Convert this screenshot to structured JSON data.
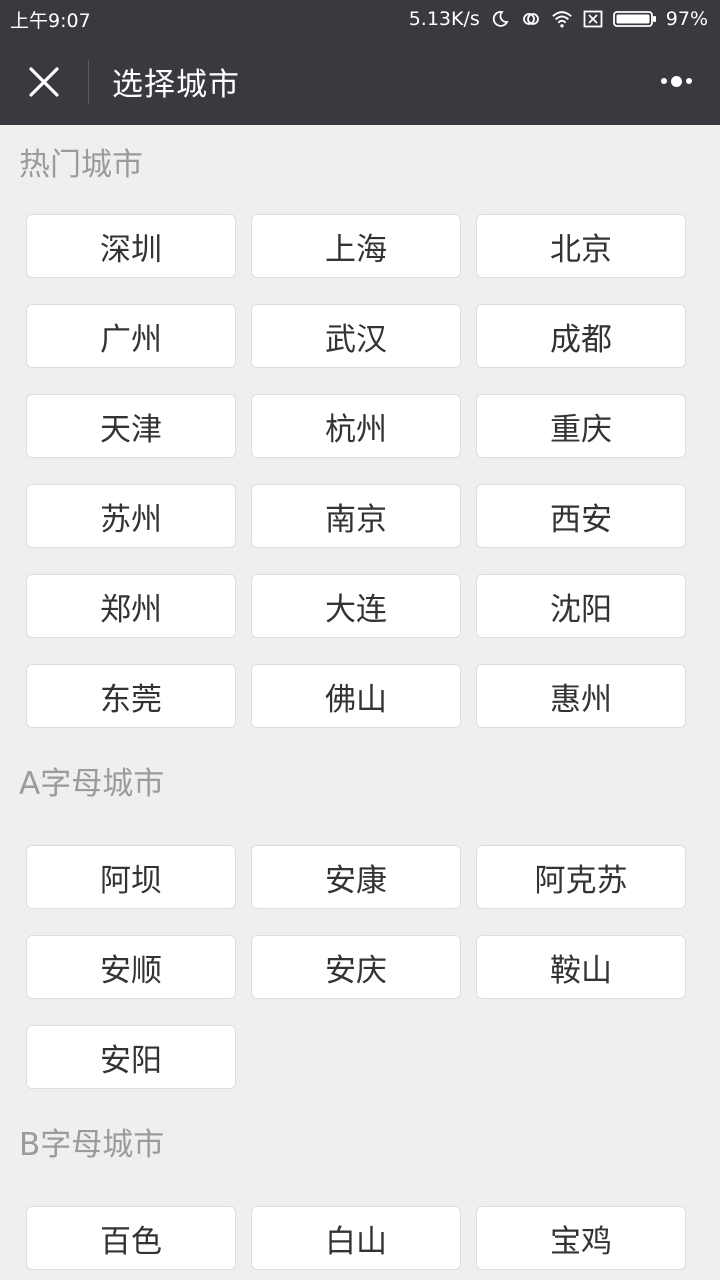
{
  "status_bar": {
    "time": "上午9:07",
    "network_speed": "5.13K/s",
    "battery_percent": "97%",
    "icons": [
      "moon-icon",
      "sync-icon",
      "wifi-icon",
      "sim-off-icon",
      "battery-icon"
    ]
  },
  "nav": {
    "title": "选择城市",
    "close_icon": "close-icon",
    "more_icon": "more-icon"
  },
  "sections": [
    {
      "title": "热门城市",
      "cities": [
        "深圳",
        "上海",
        "北京",
        "广州",
        "武汉",
        "成都",
        "天津",
        "杭州",
        "重庆",
        "苏州",
        "南京",
        "西安",
        "郑州",
        "大连",
        "沈阳",
        "东莞",
        "佛山",
        "惠州"
      ]
    },
    {
      "title": "A字母城市",
      "cities": [
        "阿坝",
        "安康",
        "阿克苏",
        "安顺",
        "安庆",
        "鞍山",
        "安阳"
      ]
    },
    {
      "title": "B字母城市",
      "cities": [
        "百色",
        "白山",
        "宝鸡"
      ]
    }
  ],
  "colors": {
    "nav_bg": "#393a3f",
    "page_bg": "#efefef",
    "section_title": "#9b9b9b",
    "button_bg": "#ffffff",
    "button_text": "#333333"
  }
}
